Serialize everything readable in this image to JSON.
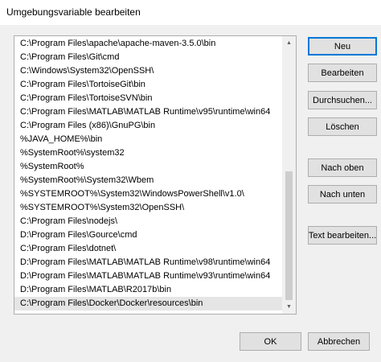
{
  "window": {
    "title": "Umgebungsvariable bearbeiten"
  },
  "paths": [
    "C:\\Program Files\\apache\\apache-maven-3.5.0\\bin",
    "C:\\Program Files\\Git\\cmd",
    "C:\\Windows\\System32\\OpenSSH\\",
    "C:\\Program Files\\TortoiseGit\\bin",
    "C:\\Program Files\\TortoiseSVN\\bin",
    "C:\\Program Files\\MATLAB\\MATLAB Runtime\\v95\\runtime\\win64",
    "C:\\Program Files (x86)\\GnuPG\\bin",
    "%JAVA_HOME%\\bin",
    "%SystemRoot%\\system32",
    "%SystemRoot%",
    "%SystemRoot%\\System32\\Wbem",
    "%SYSTEMROOT%\\System32\\WindowsPowerShell\\v1.0\\",
    "%SYSTEMROOT%\\System32\\OpenSSH\\",
    "C:\\Program Files\\nodejs\\",
    "D:\\Program Files\\Gource\\cmd",
    "C:\\Program Files\\dotnet\\",
    "D:\\Program Files\\MATLAB\\MATLAB Runtime\\v98\\runtime\\win64",
    "D:\\Program Files\\MATLAB\\MATLAB Runtime\\v93\\runtime\\win64",
    "D:\\Program Files\\MATLAB\\R2017b\\bin",
    "C:\\Program Files\\Docker\\Docker\\resources\\bin"
  ],
  "selected_index": 19,
  "buttons": {
    "new": "Neu",
    "edit": "Bearbeiten",
    "browse": "Durchsuchen...",
    "delete": "Löschen",
    "move_up": "Nach oben",
    "move_down": "Nach unten",
    "edit_text": "Text bearbeiten...",
    "ok": "OK",
    "cancel": "Abbrechen"
  },
  "icons": {
    "scroll_up": "▲",
    "scroll_down": "▼"
  }
}
